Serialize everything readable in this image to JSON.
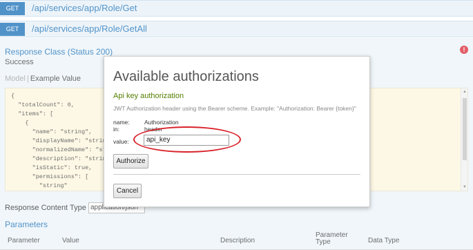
{
  "endpoints": [
    {
      "method": "GET",
      "path": "/api/services/app/Role/Get"
    },
    {
      "method": "GET",
      "path": "/api/services/app/Role/GetAll"
    }
  ],
  "response": {
    "class_title": "Response Class (Status 200)",
    "status_text": "Success",
    "error_icon": "!",
    "tabs": {
      "model": "Model",
      "separator": "|",
      "example": "Example Value"
    },
    "json_example": "{\n  \"totalCount\": 0,\n  \"items\": [\n    {\n      \"name\": \"string\",\n      \"displayName\": \"string\",\n      \"normalizedName\": \"string\",\n      \"description\": \"string\",\n      \"isStatic\": true,\n      \"permissions\": [\n        \"string\""
  },
  "content_type": {
    "label": "Response Content Type",
    "selected": "application/json"
  },
  "parameters": {
    "heading": "Parameters",
    "columns": {
      "parameter": "Parameter",
      "value": "Value",
      "description": "Description",
      "parameter_type": "Parameter Type",
      "data_type": "Data Type"
    }
  },
  "modal": {
    "title": "Available authorizations",
    "auth_heading": "Api key authorization",
    "description": "JWT Authorization header using the Bearer scheme. Example: \"Authorization: Bearer {token}\"",
    "name_label": "name:",
    "name_value": "Authorization",
    "in_label": "in:",
    "in_value": "header",
    "value_label": "value:",
    "value_input": "api_key",
    "authorize_button": "Authorize",
    "cancel_button": "Cancel"
  },
  "colors": {
    "get_badge": "#0f6ab4",
    "highlight": "#d9222a",
    "auth_heading": "#547f00"
  }
}
